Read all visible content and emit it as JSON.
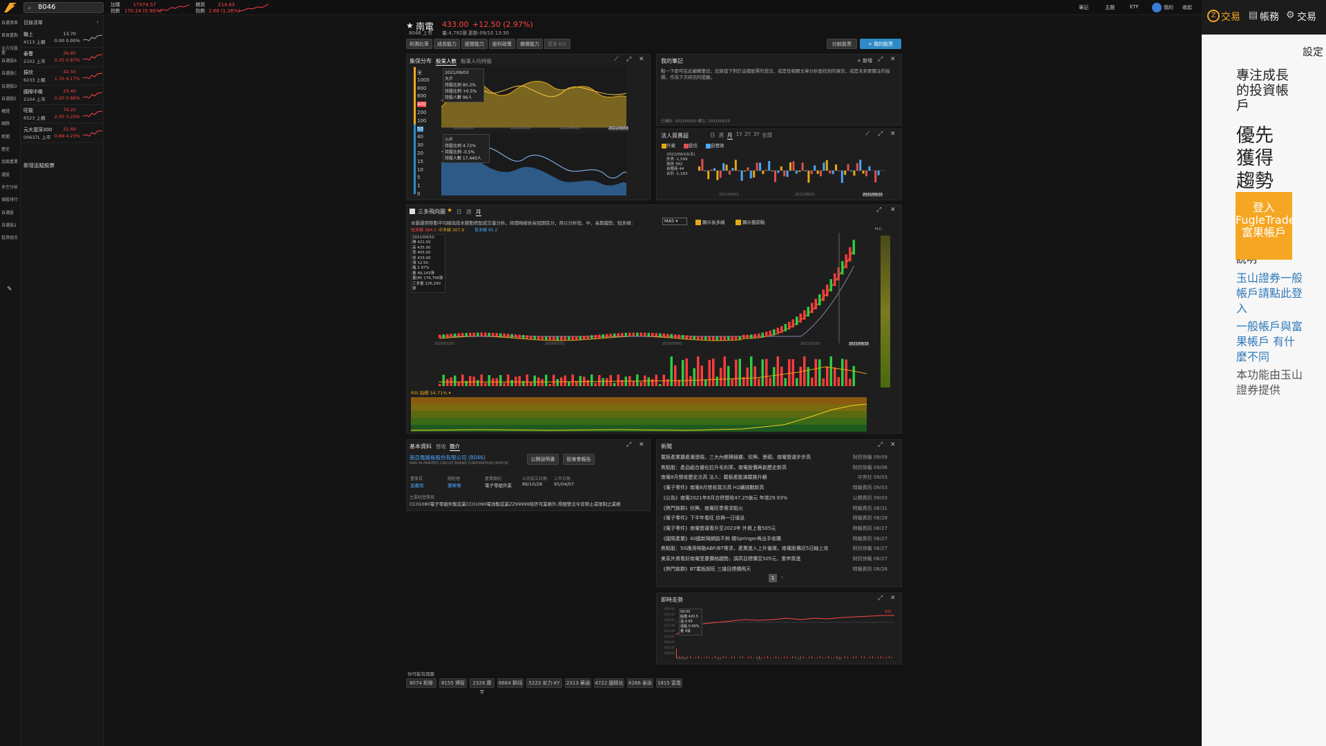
{
  "topbar": {
    "search_value": "8046",
    "index1": {
      "name_l1": "加權",
      "name_l2": "指數",
      "value": "17474.57",
      "change": "170.24 (0.98%)"
    },
    "index2": {
      "name_l1": "櫃買",
      "name_l2": "指數",
      "value": "214.63",
      "change": "2.66 (1.26%)"
    },
    "menu": [
      "筆記",
      "主題",
      "ETF",
      "我的",
      "收起"
    ]
  },
  "leftcol": [
    "自選清單",
    "首頁重點",
    "全方位股票",
    "自選股B",
    "自選股C",
    "自選股D",
    "自選股E",
    "權證",
    "國際",
    "新聞",
    "歷史",
    "追蹤產業",
    "選股",
    "多空分析",
    "個股排行",
    "自選股",
    "自選股2",
    "投資組合"
  ],
  "watch": {
    "header": "目錄清單",
    "rows": [
      {
        "name": "聯上",
        "sub": "4113 上櫃",
        "price": "13.70",
        "chg": "0.00 0.00%",
        "neutral": true
      },
      {
        "name": "泰豐",
        "sub": "2102 上市",
        "price": "26.85",
        "chg": "0.25 0.87%"
      },
      {
        "name": "振欣",
        "sub": "6233 上櫃",
        "price": "42.50",
        "chg": "1.70 4.17%"
      },
      {
        "name": "國際中橡",
        "sub": "2104 上市",
        "price": "23.40",
        "chg": "0.20 0.86%"
      },
      {
        "name": "旺能",
        "sub": "6523 上櫃",
        "price": "74.20",
        "chg": "2.30 3.20%"
      },
      {
        "name": "元大滬深300",
        "sub": "00637L 上市",
        "price": "21.66",
        "chg": "0.88 4.23%"
      }
    ],
    "add_label": "新增追蹤股票"
  },
  "stock": {
    "name": "南電",
    "price": "433.00",
    "change": "+12.50 (2.97%)",
    "code_line": "8046 上市",
    "volume": "量:4,792張",
    "updated": "更新:09/10 13:30",
    "toolbar": [
      "利潤比率",
      "成長能力",
      "經營能力",
      "股利政策",
      "償債能力",
      "更多卡片"
    ],
    "compare_btn": "比較股票",
    "my_btn": "+ 我的股票"
  },
  "chip": {
    "title": "集保分布",
    "tabs": [
      "股東人數",
      "股東人均持股"
    ],
    "levels": [
      "全",
      "1000",
      "800",
      "600",
      "400",
      "200",
      "100",
      "50",
      "40",
      "30",
      "20",
      "15",
      "10",
      "5",
      "1",
      "0"
    ],
    "top_label": "大戶",
    "bottom_label": "小戶",
    "top_date": "2021/09/03",
    "top_rows": [
      "持股比例 80.2%",
      "持股比例 +0.5%",
      "持股人數 96人"
    ],
    "bottom_rows": [
      "持股比例 4.72%",
      "持股比例 -0.5%",
      "持股人數 17,440人"
    ],
    "x_labels": [
      "2020/10/30",
      "2021/01/29",
      "2021/04/30",
      "2021/09/03"
    ]
  },
  "notes": {
    "title": "我的筆記",
    "add": "+ 新增",
    "body": "點一下即可在此編輯筆記，記錄當下對於這檔股票的想法，或是從相關文章分析面找到的資訊，或是未來要關注的指標，作為下次研究的提醒。",
    "footer": "已儲存: 2021/09/10   建立: 2021/09/10"
  },
  "inst": {
    "title": "法人買賣超",
    "tabs": [
      "日",
      "週",
      "月",
      "1Y",
      "2Y",
      "3Y",
      "全部"
    ],
    "checks": [
      "外資",
      "投信",
      "自營商"
    ],
    "date": "2021/09/10(五)",
    "rows": [
      "外資 -1,599",
      "投信 392",
      "自營商 44",
      "合計 -1,163"
    ],
    "x_labels": [
      "2021/04/01",
      "2021/06/01",
      "2021/09/10"
    ]
  },
  "kline": {
    "title": "三多飛向圖",
    "tabs": [
      "日",
      "週",
      "月"
    ],
    "desc": "本圖運用移動平均線與成本變動搭配成交量分析，將價格線依長短期區分，用以分析短、中、長期趨勢，短多線：",
    "ma_select": "MA5",
    "check1": "顯示長多線",
    "check2": "顯示盤前點",
    "legend": [
      "短多線 384.5",
      "中多線 307.9",
      "長多線 95.2"
    ],
    "ohlc": [
      "2021/09/10",
      "開 421.50",
      "高 435.00",
      "低 405.00",
      "收 433.00",
      "漲 12.50",
      "幅 2.97%",
      "量 48,143張",
      "量(M) 176,796張",
      "三多量 226,290張"
    ],
    "hl_label": "H.C.",
    "osc_label": "RSI 指標 54.71%",
    "x_labels": [
      "2020/01/01",
      "2020/07/01",
      "2020/09/01",
      "2021/01/01",
      "2021/09/10"
    ],
    "ticks": [
      "420",
      "370",
      "320",
      "270"
    ]
  },
  "basic": {
    "title": "基本資料",
    "tabs": [
      "營收",
      "簡介"
    ],
    "company": "南亞電路板股份有限公司 (8046)",
    "company_en": "NAN YA PRINTED CIRCUIT BOARD CORPORATION (NYPCB)",
    "btn1": "公開說明書",
    "btn2": "股東會報告",
    "fields": [
      {
        "k": "董事長",
        "v": "吳嘉昭"
      },
      {
        "k": "總經理",
        "v": "蕭榮傑"
      },
      {
        "k": "產業類別",
        "v": "電子零組件業"
      },
      {
        "k": "公司成立日期",
        "v": "86/10/28"
      },
      {
        "k": "上市日期",
        "v": "95/04/07"
      }
    ],
    "biz_label": "主要經營業務",
    "biz": "CC01080電子零組件製造業CC01090電池製造業ZZ99999除許可業務外,得經營法令非禁止或限制之業務"
  },
  "news": {
    "title": "新聞",
    "rows": [
      {
        "t": "載板產業擴產潮湧現，三大內都積極擴、欣興、景碩、南電營運步步高",
        "s": "財訊快報 09/09"
      },
      {
        "t": "焦點股：產品組合優化拉升毛利率，南電股價再創歷史新高",
        "s": "財訊快報 09/06"
      },
      {
        "t": "南電8月營收歷史次高 法人：載板產能滿載推升績",
        "s": "中央社 09/03"
      },
      {
        "t": "《電子零件》南電8月營收寫次高 H2續挑戰新高",
        "s": "時報資訊 09/03"
      },
      {
        "t": "《公告》南電2021年8月合併營收47.25億元 年增29.93%",
        "s": "公開資訊 09/03"
      },
      {
        "t": "《熱門族群》欣興、南電旺季需求點火",
        "s": "時報資訊 08/31"
      },
      {
        "t": "《電子零件》下半年看旺 欣興一日填息",
        "s": "時報資訊 08/28"
      },
      {
        "t": "《電子零件》南電營運看升至2023年 外資上看505元",
        "s": "時報資訊 08/27"
      },
      {
        "t": "《國際產業》40國新聞網路不夠 穩Springer再出手收購",
        "s": "時報資訊 08/27"
      },
      {
        "t": "焦點股：5G應用帶動ABF/BT需求，產業進入上升循環，南電股價近5日線上攻",
        "s": "財訊快報 08/27"
      },
      {
        "t": "美系外資看好南電受惠價格趨勢，調高目標價至505元，重申買進",
        "s": "財訊快報 08/27"
      },
      {
        "t": "《熱門族群》BT載板超旺 三雄目標價飛天",
        "s": "時報資訊 08/26"
      }
    ],
    "page": "1"
  },
  "intraday": {
    "title": "即時走勢",
    "box": [
      "09:00",
      "股價 420.5",
      "漲 0.00",
      "漲幅 0.00%",
      "量 0張"
    ],
    "right_label": "433",
    "y_labels": [
      "439.00",
      "433.00",
      "428.00",
      "423.00",
      "418.00",
      "413.00",
      "408.00",
      "403.00",
      "398.00"
    ],
    "x_labels": [
      "09:00",
      "10",
      "11",
      "12",
      "13"
    ]
  },
  "peers": {
    "title": "你可能有興趣",
    "items": [
      "8074 鉅橡",
      "8155 博智",
      "2328 廣宇",
      "6664 群翊",
      "5223 安力-KY",
      "2313 華通",
      "4722 國精化",
      "6266 泰詠",
      "1815 富喬"
    ]
  },
  "right": {
    "tabs": [
      "交易",
      "帳務",
      "交易"
    ],
    "setting": "設定",
    "promo1": "專注成長的投資帳戶",
    "promo2": "優先獲得趨勢",
    "login_btn": "登入 FugleTrade 富果帳戶",
    "link1": "玉山證券一般帳戶請點此登入",
    "link2": "一般帳戶與富果帳戶 有什麼不同",
    "footer": "本功能由玉山證券提供",
    "partial": "說明"
  },
  "colors": {
    "up": "#ff3b3b",
    "down": "#2ecc40",
    "accent": "#2e8bc7",
    "gold": "#e6a817",
    "login_bg": "#f5a623"
  }
}
